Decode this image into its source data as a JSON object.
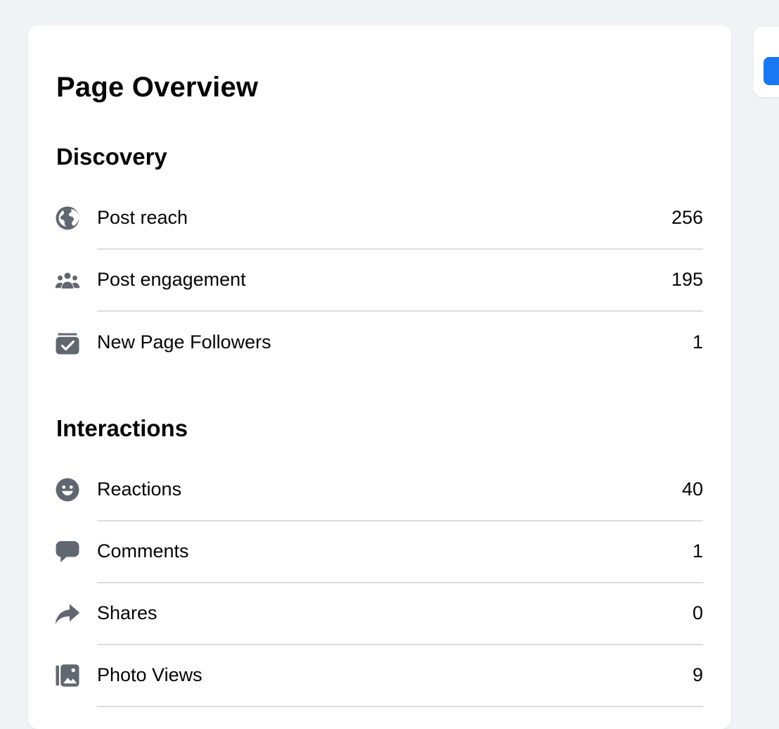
{
  "overview": {
    "title": "Page Overview"
  },
  "discovery": {
    "title": "Discovery",
    "items": [
      {
        "label": "Post reach",
        "value": "256",
        "icon": "globe-icon"
      },
      {
        "label": "Post engagement",
        "value": "195",
        "icon": "people-icon"
      },
      {
        "label": "New Page Followers",
        "value": "1",
        "icon": "follow-check-icon"
      }
    ]
  },
  "interactions": {
    "title": "Interactions",
    "items": [
      {
        "label": "Reactions",
        "value": "40",
        "icon": "smiley-icon"
      },
      {
        "label": "Comments",
        "value": "1",
        "icon": "comment-icon"
      },
      {
        "label": "Shares",
        "value": "0",
        "icon": "share-arrow-icon"
      },
      {
        "label": "Photo Views",
        "value": "9",
        "icon": "photo-icon"
      }
    ]
  },
  "colors": {
    "background": "#f0f2f5",
    "card": "#ffffff",
    "icon": "#606770",
    "divider": "#dadde1",
    "accent": "#1877f2"
  }
}
